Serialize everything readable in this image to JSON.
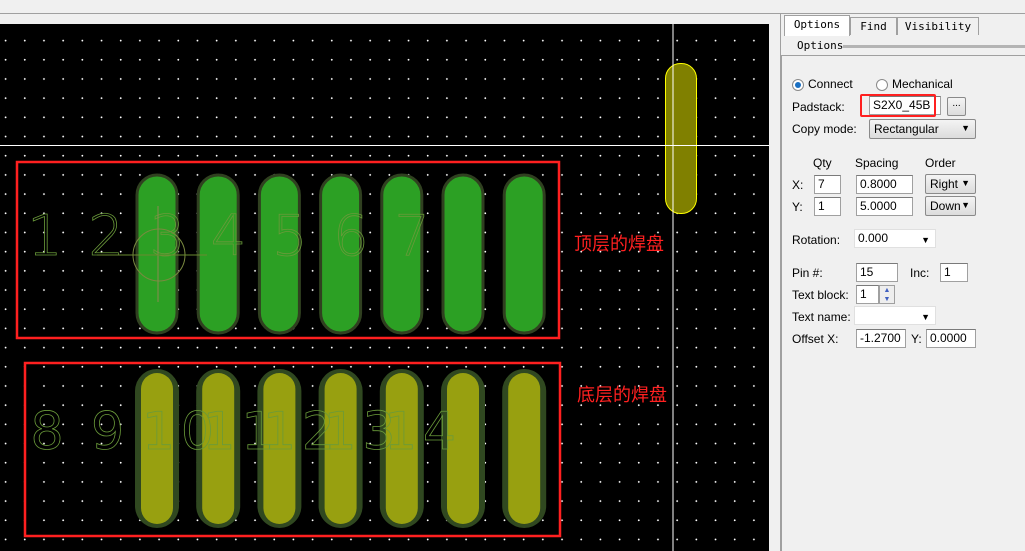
{
  "canvas": {
    "top_pads_pin_labels": [
      "1",
      "2",
      "3",
      "4",
      "5",
      "6",
      "7"
    ],
    "bottom_pads_pin_labels": [
      "8",
      "9",
      "10",
      "11",
      "12",
      "13",
      "14"
    ],
    "annotation_top": "顶层的焊盘",
    "annotation_bottom": "底层的焊盘",
    "colors": {
      "top_pad": "#2ca024",
      "bottom_pad": "#98a010",
      "floating_pad": "#808000",
      "highlight_box": "#ff2020",
      "label": "#6a9a3a"
    }
  },
  "panel": {
    "tabs": [
      "Options",
      "Find",
      "Visibility"
    ],
    "group_title": "Options",
    "radio_connect": "Connect",
    "radio_mechanical": "Mechanical",
    "padstack_label": "Padstack:",
    "padstack_value": "S2X0_45B",
    "browse_label": "...",
    "copy_mode_label": "Copy mode:",
    "copy_mode_value": "Rectangular",
    "qty_header": "Qty",
    "spacing_header": "Spacing",
    "order_header": "Order",
    "x_label": "X:",
    "y_label": "Y:",
    "qty_x": "7",
    "qty_y": "1",
    "spacing_x": "0.8000",
    "spacing_y": "5.0000",
    "order_x": "Right",
    "order_y": "Down",
    "rotation_label": "Rotation:",
    "rotation_value": "0.000",
    "pin_label": "Pin #:",
    "pin_value": "15",
    "inc_label": "Inc:",
    "inc_value": "1",
    "text_block_label": "Text block:",
    "text_block_value": "1",
    "text_name_label": "Text name:",
    "text_name_value": "",
    "offset_x_label": "Offset X:",
    "offset_x_value": "-1.2700",
    "offset_y_label": "Y:",
    "offset_y_value": "0.0000"
  }
}
